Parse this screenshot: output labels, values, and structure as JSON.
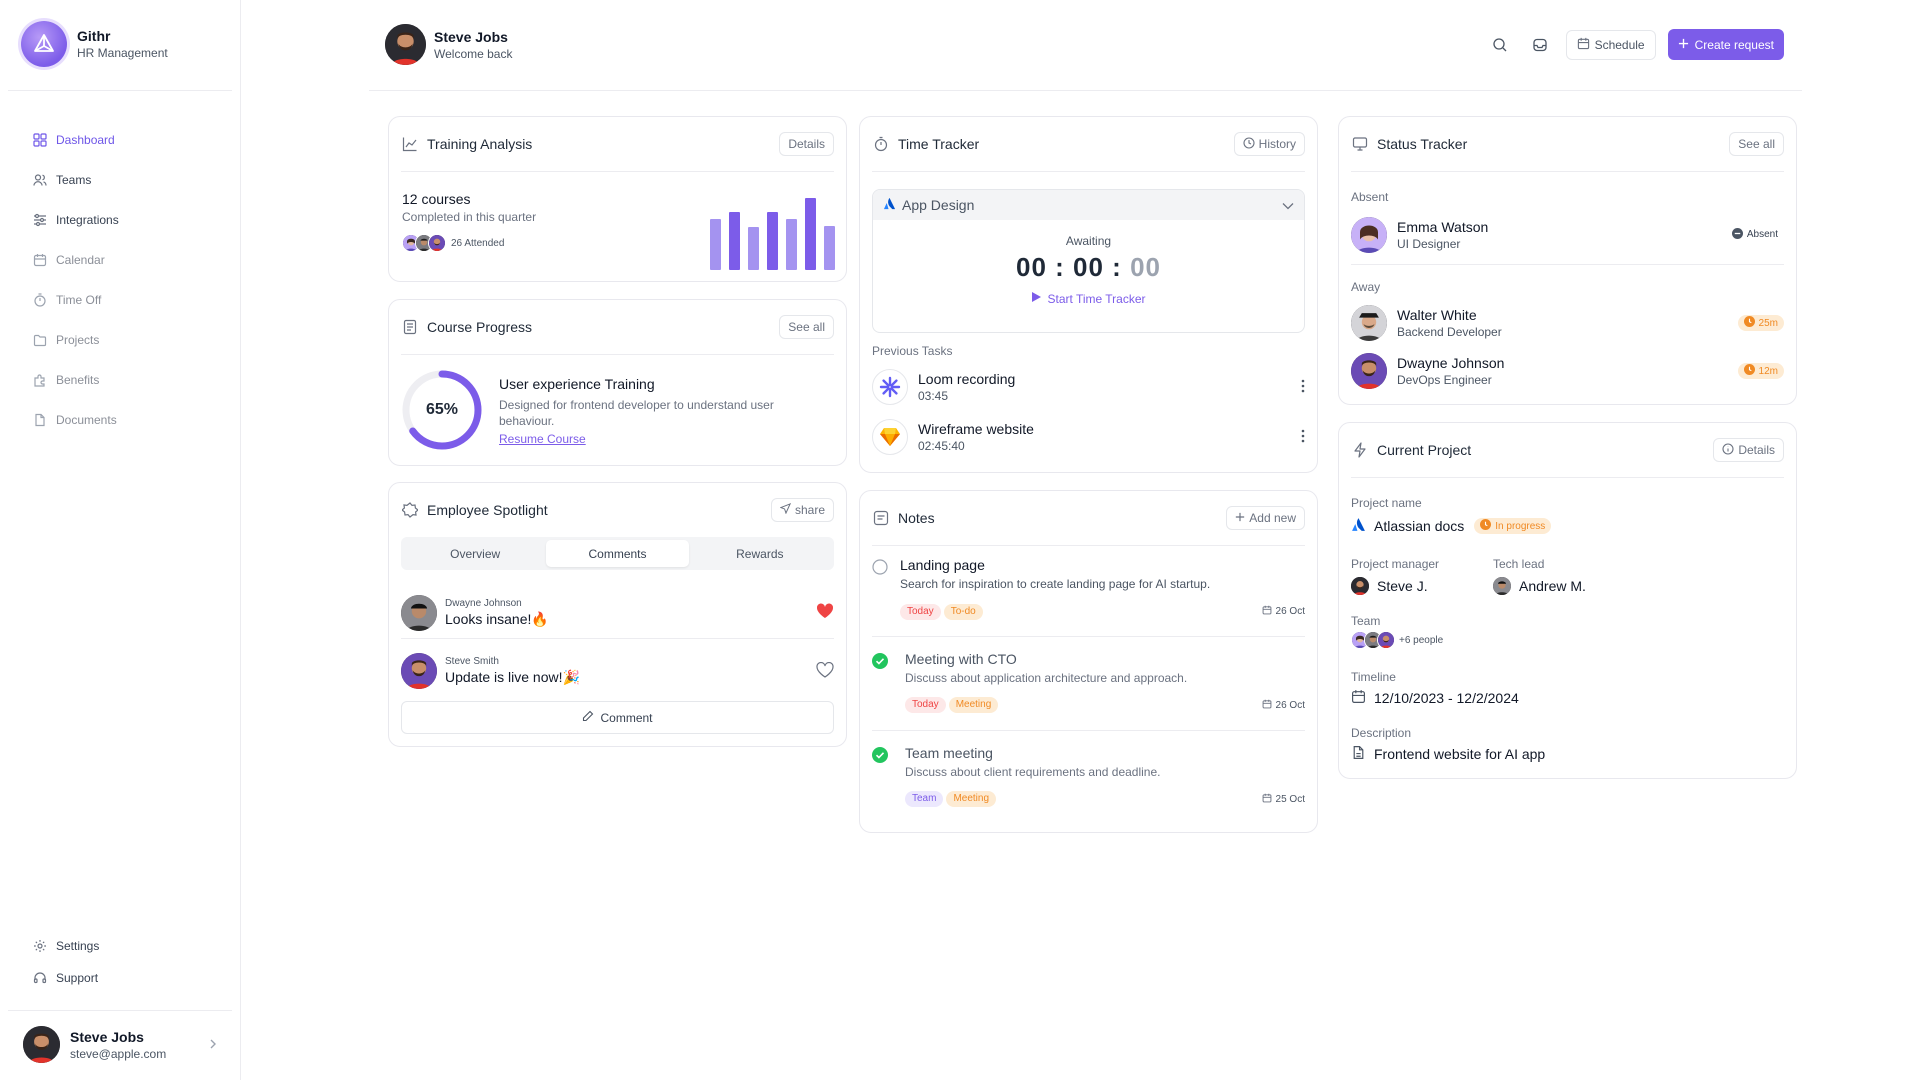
{
  "brand": {
    "name": "Githr",
    "subtitle": "HR Management"
  },
  "sidebar": {
    "items": [
      {
        "label": "Dashboard",
        "icon": "grid-icon"
      },
      {
        "label": "Teams",
        "icon": "users-icon"
      },
      {
        "label": "Integrations",
        "icon": "sliders-icon"
      },
      {
        "label": "Calendar",
        "icon": "calendar-icon"
      },
      {
        "label": "Time Off",
        "icon": "timer-icon"
      },
      {
        "label": "Projects",
        "icon": "folder-icon"
      },
      {
        "label": "Benefits",
        "icon": "puzzle-icon"
      },
      {
        "label": "Documents",
        "icon": "document-icon"
      }
    ],
    "bottom": [
      {
        "label": "Settings",
        "icon": "gear-icon"
      },
      {
        "label": "Support",
        "icon": "headset-icon"
      }
    ],
    "profile": {
      "name": "Steve Jobs",
      "email": "steve@apple.com"
    }
  },
  "header": {
    "name": "Steve Jobs",
    "subtitle": "Welcome back",
    "schedule_label": "Schedule",
    "create_label": "Create request"
  },
  "training": {
    "title": "Training Analysis",
    "details_label": "Details",
    "count": "12 courses",
    "caption": "Completed in this quarter",
    "attended": "26 Attended",
    "bars": [
      60,
      68,
      50,
      68,
      60,
      85,
      52
    ]
  },
  "course": {
    "title": "Course Progress",
    "see_all": "See all",
    "percent_label": "65%",
    "progress": 0.65,
    "name": "User experience Training",
    "description": "Designed for frontend developer to understand user behaviour.",
    "link": "Resume Course"
  },
  "spotlight": {
    "title": "Employee Spotlight",
    "share_label": "share",
    "tabs": [
      "Overview",
      "Comments",
      "Rewards"
    ],
    "comments": [
      {
        "author": "Dwayne Johnson",
        "text": "Looks insane!🔥",
        "liked": true
      },
      {
        "author": "Steve Smith",
        "text": "Update is live now!🎉",
        "liked": false
      }
    ],
    "comment_button": "Comment"
  },
  "tracker": {
    "title": "Time Tracker",
    "history_label": "History",
    "project": "App Design",
    "status": "Awaiting",
    "time": {
      "h": "00",
      "m": "00",
      "s": "00"
    },
    "start_label": "Start Time Tracker",
    "previous_label": "Previous Tasks",
    "tasks": [
      {
        "name": "Loom recording",
        "duration": "03:45"
      },
      {
        "name": "Wireframe website",
        "duration": "02:45:40"
      }
    ]
  },
  "notes": {
    "title": "Notes",
    "add_label": "Add new",
    "items": [
      {
        "title": "Landing page",
        "desc": "Search for inspiration to create landing page for AI startup.",
        "tags": [
          "Today",
          "To-do"
        ],
        "date": "26 Oct",
        "done": false
      },
      {
        "title": "Meeting with CTO",
        "desc": "Discuss about application architecture and approach.",
        "tags": [
          "Today",
          "Meeting"
        ],
        "date": "26 Oct",
        "done": true
      },
      {
        "title": "Team meeting",
        "desc": "Discuss about client requirements and deadline.",
        "tags": [
          "Team",
          "Meeting"
        ],
        "date": "25 Oct",
        "done": true
      }
    ]
  },
  "status": {
    "title": "Status Tracker",
    "see_all": "See all",
    "absent_label": "Absent",
    "away_label": "Away",
    "absent": [
      {
        "name": "Emma Watson",
        "role": "UI Designer",
        "badge": "Absent"
      }
    ],
    "away": [
      {
        "name": "Walter White",
        "role": "Backend Developer",
        "badge": "25m"
      },
      {
        "name": "Dwayne Johnson",
        "role": "DevOps Engineer",
        "badge": "12m"
      }
    ]
  },
  "project": {
    "title": "Current Project",
    "details_label": "Details",
    "name_label": "Project name",
    "name": "Atlassian docs",
    "status": "In progress",
    "manager_label": "Project manager",
    "manager": "Steve J.",
    "lead_label": "Tech lead",
    "lead": "Andrew M.",
    "team_label": "Team",
    "team_more": "+6 people",
    "timeline_label": "Timeline",
    "timeline": "12/10/2023 - 12/2/2024",
    "description_label": "Description",
    "description": "Frontend website for AI app"
  },
  "colors": {
    "accent": "#7c5ce9",
    "away": "#f08a24",
    "done": "#22c55e",
    "heart": "#ef4444"
  }
}
